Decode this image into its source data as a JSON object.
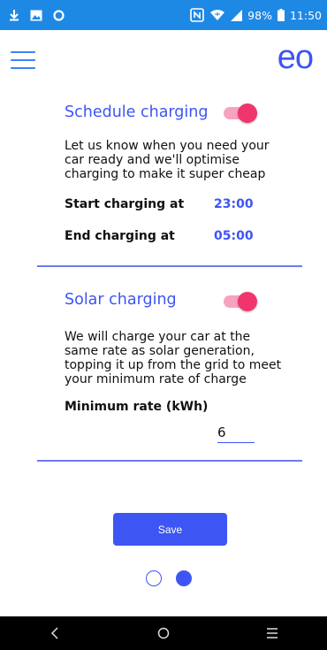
{
  "statusbar": {
    "battery_percent": "98%",
    "time": "11:50"
  },
  "header": {
    "logo": "eo"
  },
  "schedule": {
    "title": "Schedule charging",
    "enabled": true,
    "description_lines": [
      "Let us know when you need your",
      "car ready and we'll optimise",
      "charging to make it super cheap"
    ],
    "start_label": "Start charging at",
    "start_value": "23:00",
    "end_label": "End charging at",
    "end_value": "05:00"
  },
  "solar": {
    "title": "Solar charging",
    "enabled": true,
    "description_lines": [
      "We will charge your car at the",
      "same rate as solar generation,",
      "topping it up from the grid to meet",
      "your minimum rate of charge"
    ],
    "min_rate_label": "Minimum rate (kWh)",
    "min_rate_value": "6"
  },
  "actions": {
    "save_label": "Save"
  },
  "pager": {
    "current_page": 2,
    "total_pages": 2
  },
  "colors": {
    "accent": "#3d55f3",
    "status_bar": "#1e88e5",
    "toggle_on": "#f0356d"
  }
}
